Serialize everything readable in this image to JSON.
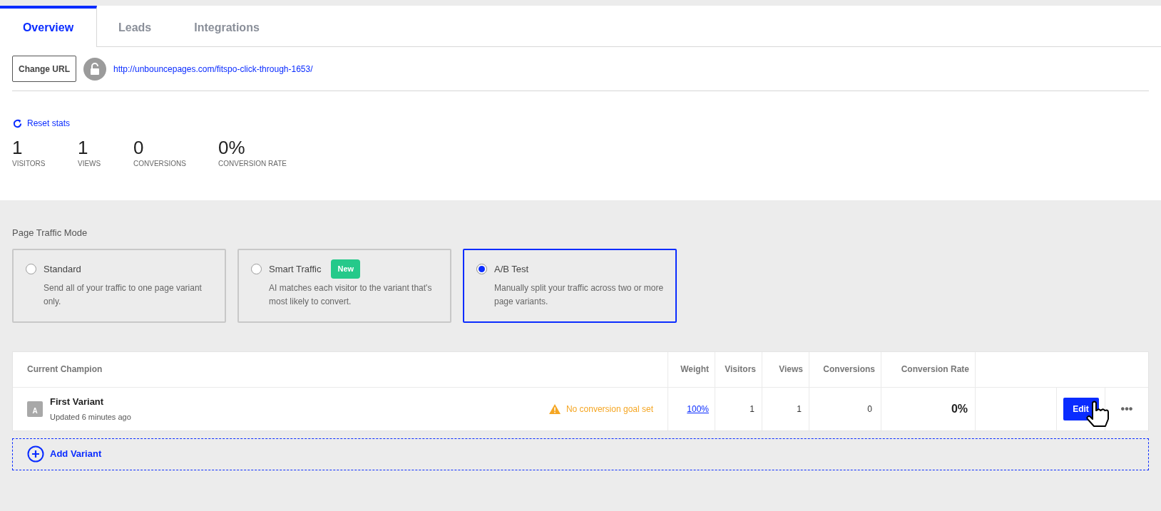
{
  "tabs": [
    {
      "label": "Overview",
      "selected": true
    },
    {
      "label": "Leads",
      "selected": false
    },
    {
      "label": "Integrations",
      "selected": false
    }
  ],
  "url_bar": {
    "button": "Change URL",
    "url": "http://unbouncepages.com/fitspo-click-through-1653/"
  },
  "reset_stats": "Reset stats",
  "stats": [
    {
      "value": "1",
      "label": "VISITORS"
    },
    {
      "value": "1",
      "label": "VIEWS"
    },
    {
      "value": "0",
      "label": "CONVERSIONS"
    },
    {
      "value": "0%",
      "label": "CONVERSION RATE"
    }
  ],
  "traffic_mode": {
    "title": "Page Traffic Mode",
    "options": [
      {
        "label": "Standard",
        "description": "Send all of your traffic to one page variant only.",
        "selected": false
      },
      {
        "label": "Smart Traffic",
        "badge": "New",
        "description": "AI matches each visitor to the variant that's most likely to convert.",
        "selected": false
      },
      {
        "label": "A/B Test",
        "description": "Manually split your traffic across two or more page variants.",
        "selected": true
      }
    ]
  },
  "table": {
    "columns": [
      "Current Champion",
      "Weight",
      "Visitors",
      "Views",
      "Conversions",
      "Conversion Rate"
    ],
    "rows": [
      {
        "letter": "A",
        "name": "First Variant",
        "updated": "Updated 6 minutes ago",
        "warning": "No conversion goal set",
        "weight": "100%",
        "visitors": "1",
        "views": "1",
        "conversions": "0",
        "conversion_rate": "0%",
        "edit": "Edit",
        "more": "•••"
      }
    ]
  },
  "add_variant": "Add Variant"
}
